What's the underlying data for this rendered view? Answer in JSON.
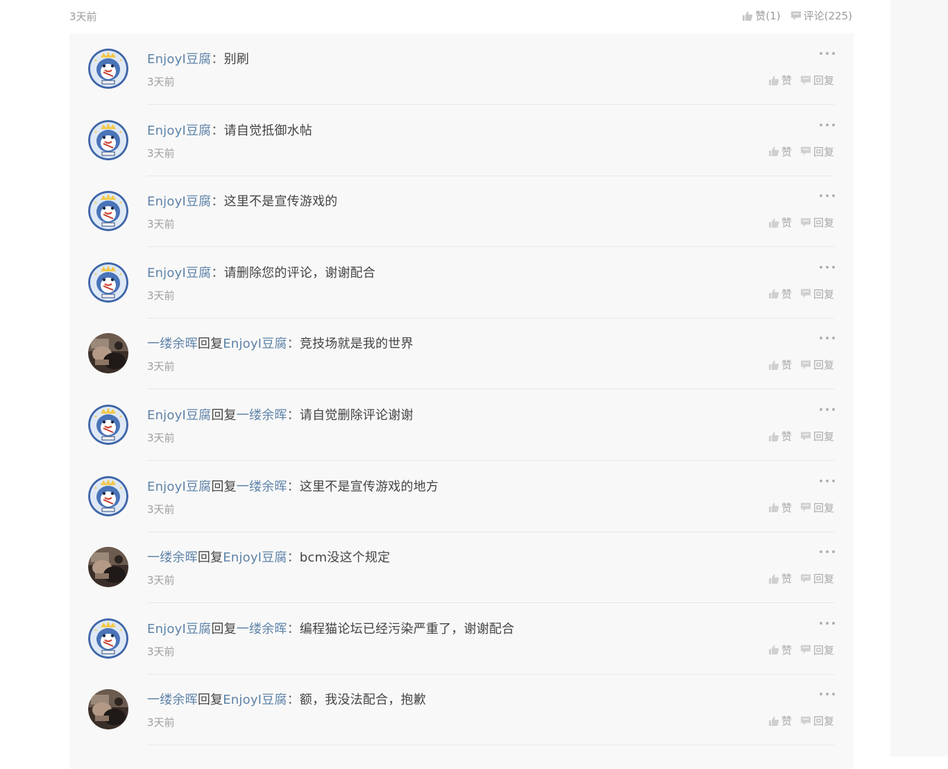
{
  "post": {
    "time": "3天前",
    "like_label": "赞(1)",
    "comment_label": "评论(225)"
  },
  "comment_actions": {
    "like": "赞",
    "reply": "回复"
  },
  "comments": [
    {
      "user": "EnjoyI豆腐",
      "reply_word": "",
      "target": "",
      "colon": "：",
      "text": "别刷",
      "time": "3天前",
      "avatar": "penguin"
    },
    {
      "user": "EnjoyI豆腐",
      "reply_word": "",
      "target": "",
      "colon": "：",
      "text": "请自觉抵御水帖",
      "time": "3天前",
      "avatar": "penguin"
    },
    {
      "user": "EnjoyI豆腐",
      "reply_word": "",
      "target": "",
      "colon": "：",
      "text": "这里不是宣传游戏的",
      "time": "3天前",
      "avatar": "penguin"
    },
    {
      "user": "EnjoyI豆腐",
      "reply_word": "",
      "target": "",
      "colon": "：",
      "text": "请删除您的评论，谢谢配合",
      "time": "3天前",
      "avatar": "penguin"
    },
    {
      "user": "一缕余晖",
      "reply_word": "回复",
      "target": "EnjoyI豆腐",
      "colon": "：",
      "text": "竞技场就是我的世界",
      "time": "3天前",
      "avatar": "photo"
    },
    {
      "user": "EnjoyI豆腐",
      "reply_word": "回复",
      "target": "一缕余晖",
      "colon": "：",
      "text": "请自觉删除评论谢谢",
      "time": "3天前",
      "avatar": "penguin"
    },
    {
      "user": "EnjoyI豆腐",
      "reply_word": "回复",
      "target": "一缕余晖",
      "colon": "：",
      "text": "这里不是宣传游戏的地方",
      "time": "3天前",
      "avatar": "penguin"
    },
    {
      "user": "一缕余晖",
      "reply_word": "回复",
      "target": "EnjoyI豆腐",
      "colon": "：",
      "text": "bcm没这个规定",
      "time": "3天前",
      "avatar": "photo"
    },
    {
      "user": "EnjoyI豆腐",
      "reply_word": "回复",
      "target": "一缕余晖",
      "colon": "：",
      "text": "编程猫论坛已经污染严重了，谢谢配合",
      "time": "3天前",
      "avatar": "penguin"
    },
    {
      "user": "一缕余晖",
      "reply_word": "回复",
      "target": "EnjoyI豆腐",
      "colon": "：",
      "text": "额，我没法配合，抱歉",
      "time": "3天前",
      "avatar": "photo"
    }
  ],
  "icons": {
    "thumb": "thumbs-up-icon",
    "bubble": "comment-bubble-icon",
    "more": "more-dots-icon"
  },
  "colors": {
    "username": "#5e83a8",
    "muted": "#9e9e9e",
    "panel_bg": "#f8f8f8"
  }
}
